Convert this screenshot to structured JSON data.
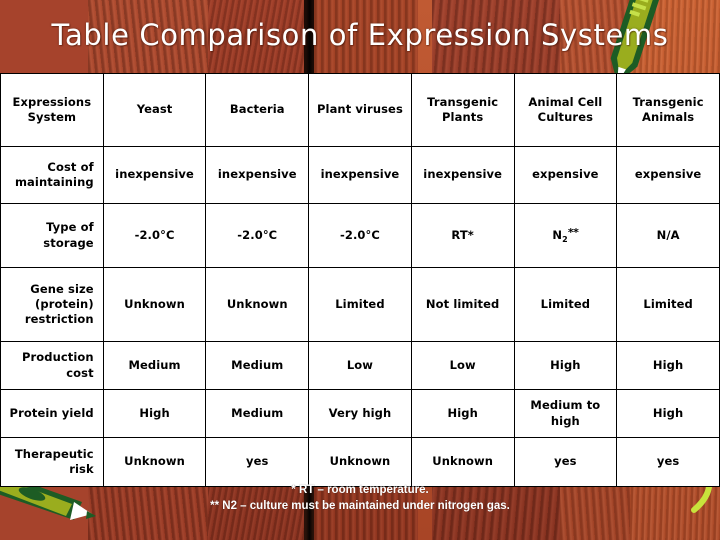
{
  "slide": {
    "title": "Table Comparison of Expression Systems"
  },
  "table": {
    "columns": [
      "Expressions System",
      "Yeast",
      "Bacteria",
      "Plant viruses",
      "Transgenic Plants",
      "Animal Cell Cultures",
      "Transgenic Animals"
    ],
    "column_lines": [
      [
        "Expressions",
        "System"
      ],
      [
        "Yeast"
      ],
      [
        "Bacteria"
      ],
      [
        "Plant viruses"
      ],
      [
        "Transgenic",
        "Plants"
      ],
      [
        "Animal Cell",
        "Cultures"
      ],
      [
        "Transgenic",
        "Animals"
      ]
    ],
    "rows": [
      {
        "header_lines": [
          "Cost of",
          "maintaining"
        ],
        "cells": [
          "inexpensive",
          "inexpensive",
          "inexpensive",
          "inexpensive",
          "expensive",
          "expensive"
        ]
      },
      {
        "header_lines": [
          "Type of",
          "storage"
        ],
        "cells": [
          "-2.0°C",
          "-2.0°C",
          "-2.0°C",
          "RT*",
          "N2**",
          "N/A"
        ]
      },
      {
        "header_lines": [
          "Gene size",
          "(protein)",
          "restriction"
        ],
        "cells": [
          "Unknown",
          "Unknown",
          "Limited",
          "Not limited",
          "Limited",
          "Limited"
        ]
      },
      {
        "header_lines": [
          "Production",
          "cost"
        ],
        "cells": [
          "Medium",
          "Medium",
          "Low",
          "Low",
          "High",
          "High"
        ]
      },
      {
        "header_lines": [
          "Protein yield"
        ],
        "cells": [
          "High",
          "Medium",
          "Very high",
          "High",
          "Medium to high",
          "High"
        ]
      },
      {
        "header_lines": [
          "Therapeutic",
          "risk"
        ],
        "cells": [
          "Unknown",
          "yes",
          "Unknown",
          "Unknown",
          "yes",
          "yes"
        ]
      }
    ]
  },
  "footnotes": {
    "line1": "* RT – room temperature.",
    "line2": "** N2 – culture must be maintained under nitrogen gas."
  },
  "colors": {
    "background_wood": "#a03c26",
    "table_background": "#ffffff",
    "table_border": "#000000",
    "title_text": "#ffffff",
    "footnote_text": "#ffffff",
    "pencil_green_dark": "#1d5c24",
    "pencil_green_light": "#9aad1e",
    "squiggle_yellow": "#c8e33c"
  }
}
